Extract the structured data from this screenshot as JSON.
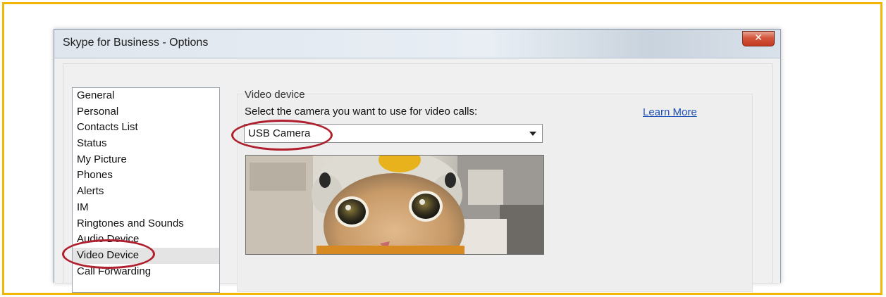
{
  "window": {
    "title": "Skype for Business - Options",
    "close_glyph": "✕"
  },
  "sidebar": {
    "items": [
      {
        "label": "General"
      },
      {
        "label": "Personal"
      },
      {
        "label": "Contacts List"
      },
      {
        "label": "Status"
      },
      {
        "label": "My Picture"
      },
      {
        "label": "Phones"
      },
      {
        "label": "Alerts"
      },
      {
        "label": "IM"
      },
      {
        "label": "Ringtones and Sounds"
      },
      {
        "label": "Audio Device"
      },
      {
        "label": "Video Device",
        "selected": true
      },
      {
        "label": "Call Forwarding"
      }
    ]
  },
  "video_device": {
    "section_title": "Video device",
    "prompt": "Select the camera you want to use for video calls:",
    "learn_more": "Learn More",
    "selected_camera": "USB Camera"
  },
  "colors": {
    "frame": "#f2b705",
    "annotation": "#b01f2d",
    "link": "#1e4fb4"
  }
}
